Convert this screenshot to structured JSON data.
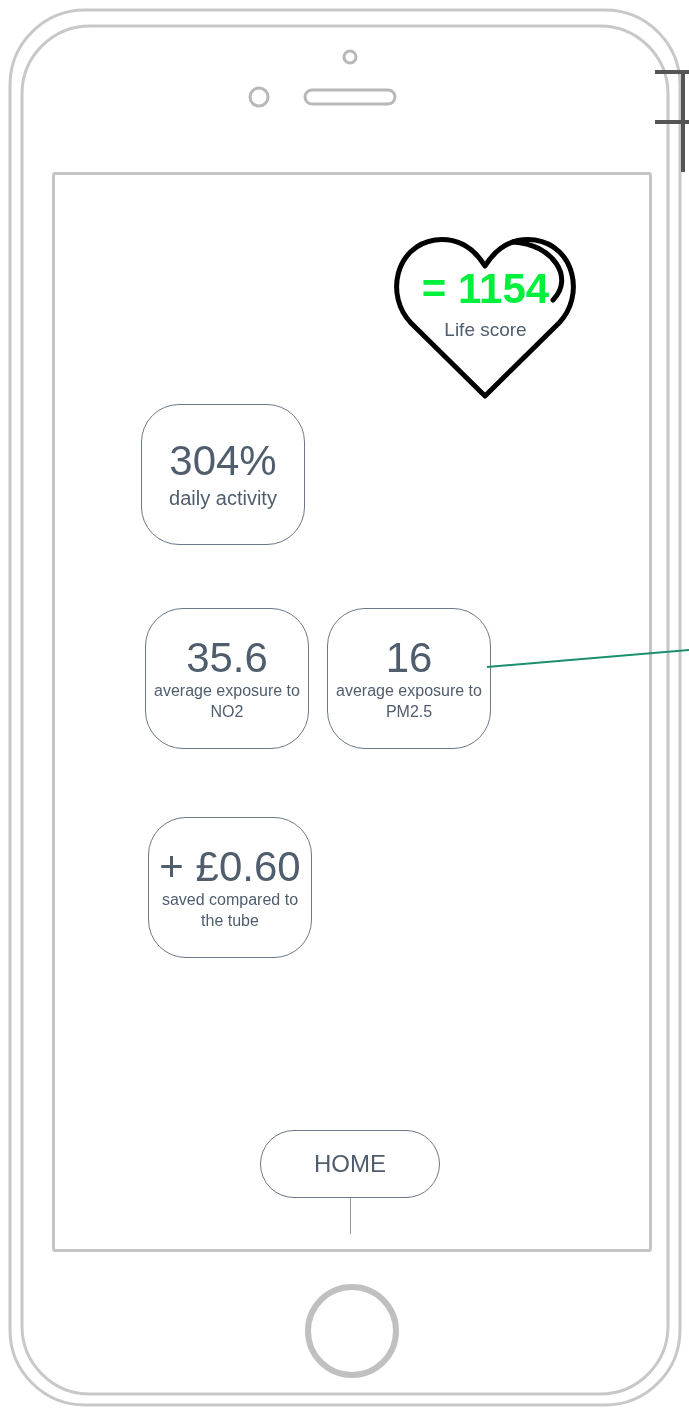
{
  "life_score": {
    "value": "= 1154",
    "label": "Life score"
  },
  "stat_rows": [
    [
      {
        "value": "304%",
        "label": "daily activity"
      }
    ],
    [
      {
        "value": "35.6",
        "label": "average exposure to NO2"
      },
      {
        "value": "16",
        "label": "average exposure to PM2.5"
      }
    ],
    [
      {
        "value": "+ £0.60",
        "label": "saved compared to the tube"
      }
    ]
  ],
  "home_button": "HOME"
}
